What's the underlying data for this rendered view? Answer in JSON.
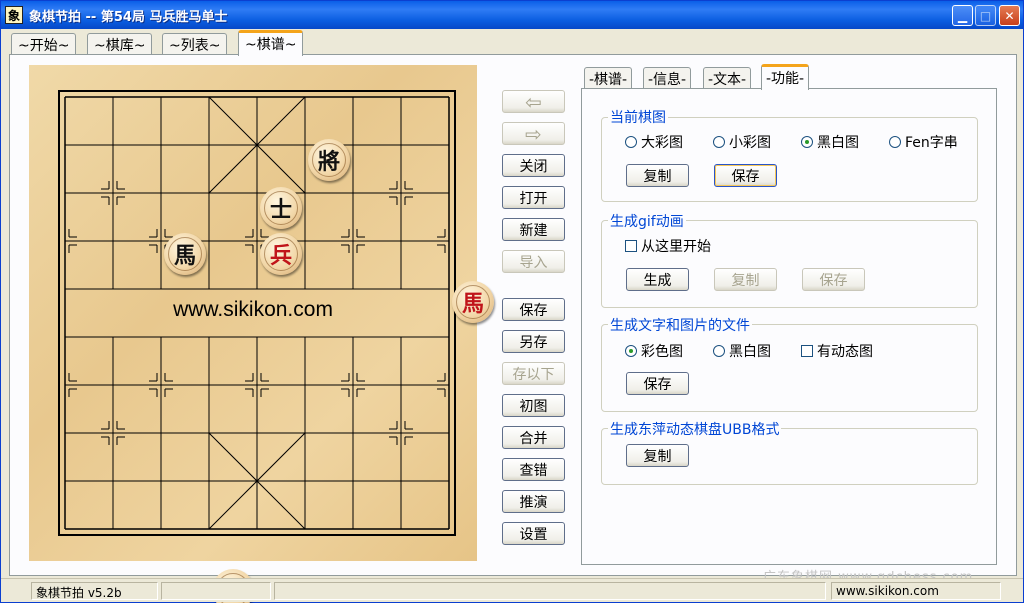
{
  "window": {
    "title": "象棋节拍  -- 第54局 马兵胜马单士",
    "app_icon": "xiangqi-app-icon",
    "icon_glyph": "象"
  },
  "main_tabs": [
    {
      "label": "~开始~"
    },
    {
      "label": "~棋库~"
    },
    {
      "label": "~列表~"
    },
    {
      "label": "~棋谱~",
      "active": true
    }
  ],
  "board": {
    "watermark": "www.sikikon.com",
    "pieces": [
      {
        "char": "將",
        "side": "black"
      },
      {
        "char": "士",
        "side": "black"
      },
      {
        "char": "馬",
        "side": "black"
      },
      {
        "char": "兵",
        "side": "red"
      },
      {
        "char": "馬",
        "side": "red"
      },
      {
        "char": "帥",
        "side": "red"
      }
    ]
  },
  "center_buttons": {
    "back_icon": "back-arrow-icon",
    "forward_icon": "forward-arrow-icon",
    "back_glyph": "⇦",
    "forward_glyph": "⇨",
    "close": "关闭",
    "open": "打开",
    "new": "新建",
    "import": "导入",
    "save": "保存",
    "save_as": "另存",
    "save_below": "存以下",
    "initial": "初图",
    "merge": "合并",
    "check_errors": "查错",
    "deduce": "推演",
    "settings": "设置"
  },
  "sub_tabs": [
    {
      "label": "-棋谱-"
    },
    {
      "label": "-信息-"
    },
    {
      "label": "-文本-"
    },
    {
      "label": "-功能-",
      "active": true
    }
  ],
  "groups": {
    "current_image": {
      "title": "当前棋图",
      "options": [
        "大彩图",
        "小彩图",
        "黑白图",
        "Fen字串"
      ],
      "selected": "黑白图",
      "copy": "复制",
      "save": "保存"
    },
    "gif": {
      "title": "生成gif动画",
      "start_here": "从这里开始",
      "generate": "生成",
      "copy": "复制",
      "save": "保存"
    },
    "text_image_file": {
      "title": "生成文字和图片的文件",
      "options": [
        "彩色图",
        "黑白图"
      ],
      "selected": "彩色图",
      "animated": "有动态图",
      "save": "保存"
    },
    "ubb": {
      "title": "生成东萍动态棋盘UBB格式",
      "copy": "复制"
    }
  },
  "watermark_text": "广东象棋网 www.gdchess.com",
  "status": {
    "version": "象棋节拍 v5.2b",
    "site": "www.sikikon.com"
  }
}
